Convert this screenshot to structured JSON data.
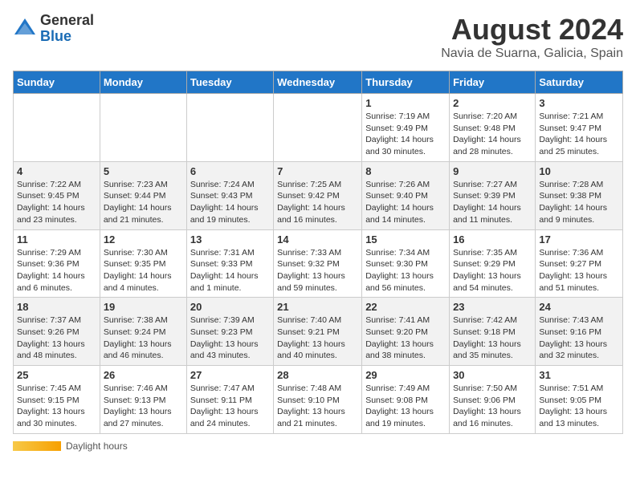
{
  "header": {
    "logo_general": "General",
    "logo_blue": "Blue",
    "month_title": "August 2024",
    "location": "Navia de Suarna, Galicia, Spain"
  },
  "days_of_week": [
    "Sunday",
    "Monday",
    "Tuesday",
    "Wednesday",
    "Thursday",
    "Friday",
    "Saturday"
  ],
  "weeks": [
    [
      {
        "day": "",
        "info": ""
      },
      {
        "day": "",
        "info": ""
      },
      {
        "day": "",
        "info": ""
      },
      {
        "day": "",
        "info": ""
      },
      {
        "day": "1",
        "info": "Sunrise: 7:19 AM\nSunset: 9:49 PM\nDaylight: 14 hours and 30 minutes."
      },
      {
        "day": "2",
        "info": "Sunrise: 7:20 AM\nSunset: 9:48 PM\nDaylight: 14 hours and 28 minutes."
      },
      {
        "day": "3",
        "info": "Sunrise: 7:21 AM\nSunset: 9:47 PM\nDaylight: 14 hours and 25 minutes."
      }
    ],
    [
      {
        "day": "4",
        "info": "Sunrise: 7:22 AM\nSunset: 9:45 PM\nDaylight: 14 hours and 23 minutes."
      },
      {
        "day": "5",
        "info": "Sunrise: 7:23 AM\nSunset: 9:44 PM\nDaylight: 14 hours and 21 minutes."
      },
      {
        "day": "6",
        "info": "Sunrise: 7:24 AM\nSunset: 9:43 PM\nDaylight: 14 hours and 19 minutes."
      },
      {
        "day": "7",
        "info": "Sunrise: 7:25 AM\nSunset: 9:42 PM\nDaylight: 14 hours and 16 minutes."
      },
      {
        "day": "8",
        "info": "Sunrise: 7:26 AM\nSunset: 9:40 PM\nDaylight: 14 hours and 14 minutes."
      },
      {
        "day": "9",
        "info": "Sunrise: 7:27 AM\nSunset: 9:39 PM\nDaylight: 14 hours and 11 minutes."
      },
      {
        "day": "10",
        "info": "Sunrise: 7:28 AM\nSunset: 9:38 PM\nDaylight: 14 hours and 9 minutes."
      }
    ],
    [
      {
        "day": "11",
        "info": "Sunrise: 7:29 AM\nSunset: 9:36 PM\nDaylight: 14 hours and 6 minutes."
      },
      {
        "day": "12",
        "info": "Sunrise: 7:30 AM\nSunset: 9:35 PM\nDaylight: 14 hours and 4 minutes."
      },
      {
        "day": "13",
        "info": "Sunrise: 7:31 AM\nSunset: 9:33 PM\nDaylight: 14 hours and 1 minute."
      },
      {
        "day": "14",
        "info": "Sunrise: 7:33 AM\nSunset: 9:32 PM\nDaylight: 13 hours and 59 minutes."
      },
      {
        "day": "15",
        "info": "Sunrise: 7:34 AM\nSunset: 9:30 PM\nDaylight: 13 hours and 56 minutes."
      },
      {
        "day": "16",
        "info": "Sunrise: 7:35 AM\nSunset: 9:29 PM\nDaylight: 13 hours and 54 minutes."
      },
      {
        "day": "17",
        "info": "Sunrise: 7:36 AM\nSunset: 9:27 PM\nDaylight: 13 hours and 51 minutes."
      }
    ],
    [
      {
        "day": "18",
        "info": "Sunrise: 7:37 AM\nSunset: 9:26 PM\nDaylight: 13 hours and 48 minutes."
      },
      {
        "day": "19",
        "info": "Sunrise: 7:38 AM\nSunset: 9:24 PM\nDaylight: 13 hours and 46 minutes."
      },
      {
        "day": "20",
        "info": "Sunrise: 7:39 AM\nSunset: 9:23 PM\nDaylight: 13 hours and 43 minutes."
      },
      {
        "day": "21",
        "info": "Sunrise: 7:40 AM\nSunset: 9:21 PM\nDaylight: 13 hours and 40 minutes."
      },
      {
        "day": "22",
        "info": "Sunrise: 7:41 AM\nSunset: 9:20 PM\nDaylight: 13 hours and 38 minutes."
      },
      {
        "day": "23",
        "info": "Sunrise: 7:42 AM\nSunset: 9:18 PM\nDaylight: 13 hours and 35 minutes."
      },
      {
        "day": "24",
        "info": "Sunrise: 7:43 AM\nSunset: 9:16 PM\nDaylight: 13 hours and 32 minutes."
      }
    ],
    [
      {
        "day": "25",
        "info": "Sunrise: 7:45 AM\nSunset: 9:15 PM\nDaylight: 13 hours and 30 minutes."
      },
      {
        "day": "26",
        "info": "Sunrise: 7:46 AM\nSunset: 9:13 PM\nDaylight: 13 hours and 27 minutes."
      },
      {
        "day": "27",
        "info": "Sunrise: 7:47 AM\nSunset: 9:11 PM\nDaylight: 13 hours and 24 minutes."
      },
      {
        "day": "28",
        "info": "Sunrise: 7:48 AM\nSunset: 9:10 PM\nDaylight: 13 hours and 21 minutes."
      },
      {
        "day": "29",
        "info": "Sunrise: 7:49 AM\nSunset: 9:08 PM\nDaylight: 13 hours and 19 minutes."
      },
      {
        "day": "30",
        "info": "Sunrise: 7:50 AM\nSunset: 9:06 PM\nDaylight: 13 hours and 16 minutes."
      },
      {
        "day": "31",
        "info": "Sunrise: 7:51 AM\nSunset: 9:05 PM\nDaylight: 13 hours and 13 minutes."
      }
    ]
  ],
  "footer": {
    "daylight_label": "Daylight hours"
  }
}
